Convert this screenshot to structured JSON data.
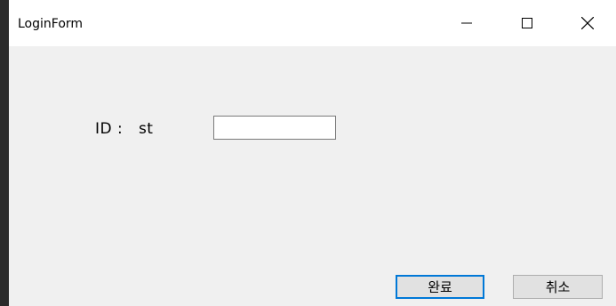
{
  "window": {
    "title": "LoginForm",
    "controls": {
      "minimize": "minimize-icon",
      "maximize": "maximize-icon",
      "close": "close-icon"
    }
  },
  "form": {
    "id_label": "ID :   st",
    "id_input": {
      "value": "",
      "placeholder": ""
    },
    "confirm_label": "완료",
    "cancel_label": "취소"
  },
  "colors": {
    "titlebar": "#ffffff",
    "client_bg": "#f0f0f0",
    "button_bg": "#e1e1e1",
    "default_button_border": "#0078d7",
    "frame": "#2b2b2b"
  }
}
